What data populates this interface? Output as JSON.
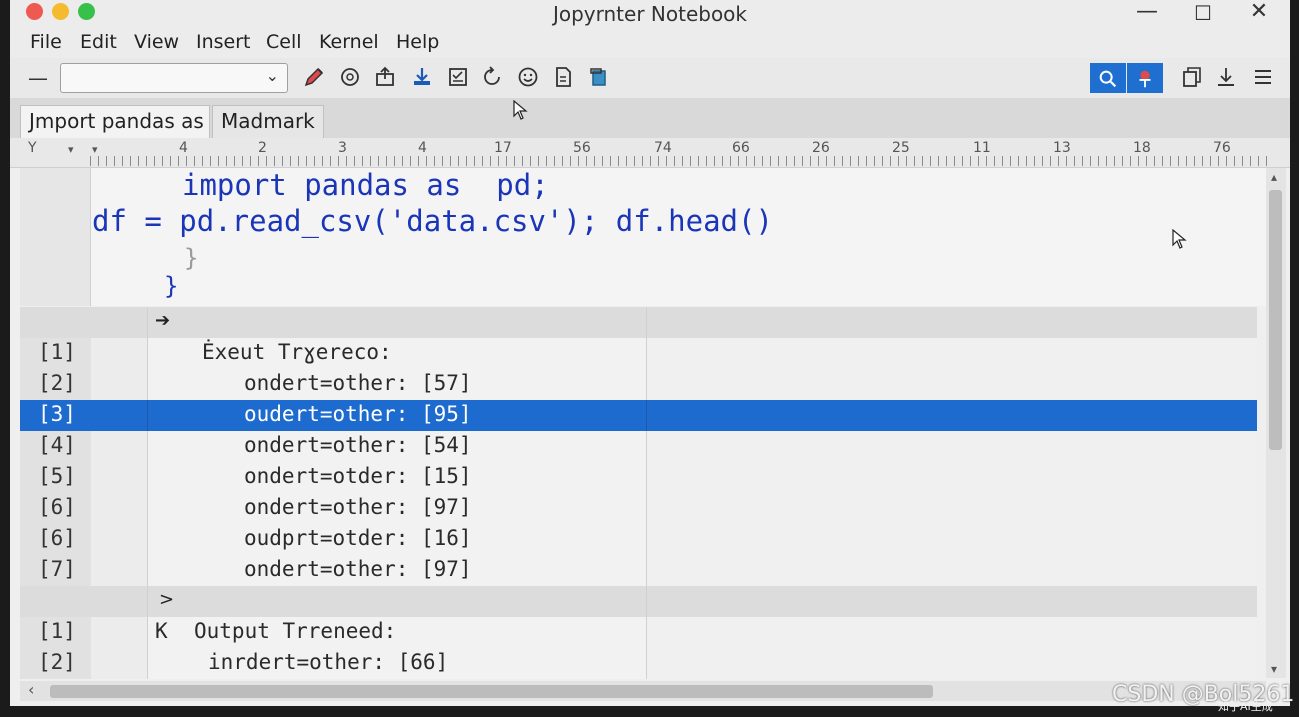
{
  "window": {
    "title": "Jopyrnter Notebook",
    "minimize": "—",
    "maximize": "☐",
    "close": "✕"
  },
  "menu": [
    "File",
    "Edit",
    "View",
    "Insert",
    "Cell",
    "Kernel",
    "Help"
  ],
  "toolbar": {
    "collapse_glyph": "—",
    "cell_type_value": "",
    "chevron": "⌄"
  },
  "tabs": [
    "Jmport pandas as",
    "Madmark"
  ],
  "ruler": {
    "left_marks": [
      "Y",
      "▾",
      "▾"
    ],
    "marks": [
      "4",
      "2",
      "3",
      "4",
      "17",
      "56",
      "74",
      "66",
      "26",
      "25",
      "11",
      "13",
      "18",
      "76"
    ]
  },
  "code": {
    "line1": "import pandas as  pd;",
    "line2": "df = pd.read_csv('data.csv'); df.head()",
    "brace1": "}",
    "brace2": "}"
  },
  "output1": {
    "arrow": "➔",
    "header_index": "[1]",
    "header": "Ėxeut Trɣereco:",
    "rows": [
      {
        "idx": "[2]",
        "text": "ondert=other: [57]"
      },
      {
        "idx": "[3]",
        "text": "oudert=other: [95]"
      },
      {
        "idx": "[4]",
        "text": "ondert=other: [54]"
      },
      {
        "idx": "[5]",
        "text": "ondert=otder: [15]"
      },
      {
        "idx": "[6]",
        "text": "ondert=other: [97]"
      },
      {
        "idx": "[6]",
        "text": "oudprt=otder: [16]"
      },
      {
        "idx": "[7]",
        "text": "ondert=other: [97]"
      }
    ],
    "selected_row": 1
  },
  "output2": {
    "arrow": ">",
    "header_index": "[1]",
    "header_prefix": "K",
    "header": "Output Trreneed:",
    "rows": [
      {
        "idx": "[2]",
        "text": "inrdert=other: [66]"
      }
    ]
  },
  "scroll": {
    "left_arrow": "‹",
    "up_arrow": "▴",
    "down_arrow": "▾"
  },
  "watermark": {
    "main": "CSDN @Bol5261",
    "sub": "知乎AI生成"
  },
  "colors": {
    "accent": "#1e6bd0",
    "code_text": "#1a35b8",
    "close_red": "#ee5a52",
    "minimize_yellow": "#f4bb2f",
    "zoom_green": "#38c14a"
  }
}
